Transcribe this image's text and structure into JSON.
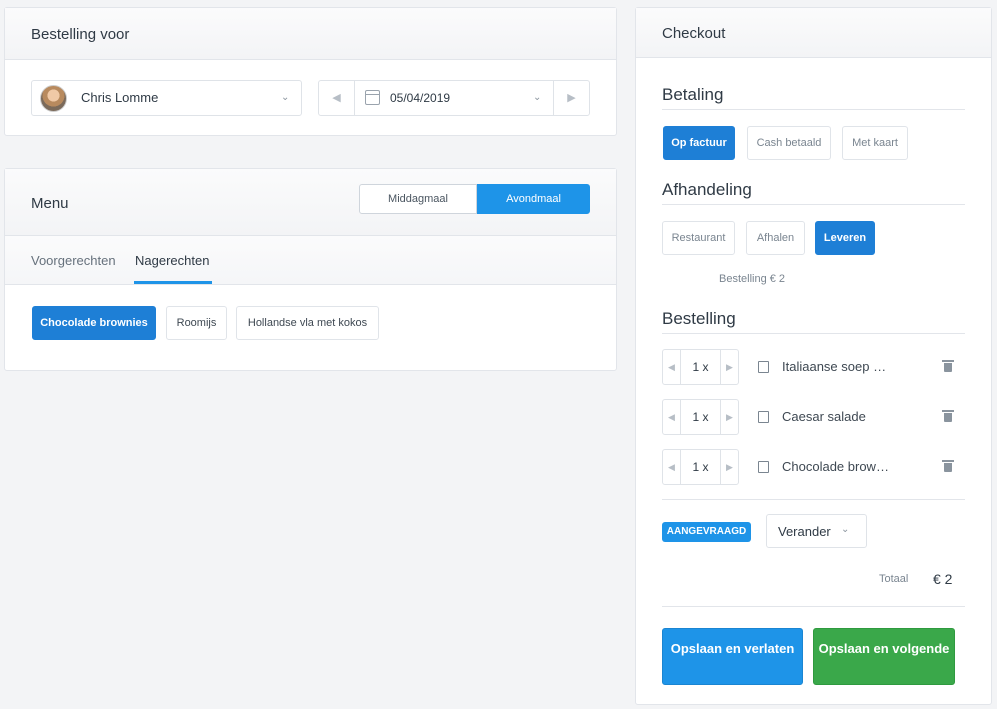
{
  "order": {
    "header": "Bestelling voor",
    "customer_name": "Chris Lomme",
    "date": "05/04/2019"
  },
  "menu": {
    "header": "Menu",
    "segments": [
      "Middagmaal",
      "Avondmaal"
    ],
    "active_segment": "Avondmaal",
    "tabs": [
      "Voorgerechten",
      "Nagerechten"
    ],
    "active_tab": "Nagerechten",
    "dishes": [
      "Chocolade brownies",
      "Roomijs",
      "Hollandse vla met kokos"
    ],
    "selected_dish": "Chocolade brownies"
  },
  "checkout": {
    "header": "Checkout",
    "payment": {
      "title": "Betaling",
      "options": [
        "Op factuur",
        "Cash betaald",
        "Met kaart"
      ],
      "selected": "Op factuur"
    },
    "handling": {
      "title": "Afhandeling",
      "options": [
        "Restaurant",
        "Afhalen",
        "Leveren"
      ],
      "selected": "Leveren",
      "note": "Bestelling € 2"
    },
    "order": {
      "title": "Bestelling",
      "items": [
        {
          "qty": "1 x",
          "name": "Italiaanse soep met balletjes"
        },
        {
          "qty": "1 x",
          "name": "Caesar salade"
        },
        {
          "qty": "1 x",
          "name": "Chocolade brownies"
        }
      ]
    },
    "status": "AANGEVRAAGD",
    "change_label": "Verander",
    "total_label": "Totaal",
    "total_value": "€ 2",
    "save_leave": "Opslaan en verlaten",
    "save_next": "Opslaan en volgende"
  },
  "colors": {
    "primary": "#1e94e8",
    "primary_dark": "#1e7fd6",
    "success": "#3aa84a"
  }
}
